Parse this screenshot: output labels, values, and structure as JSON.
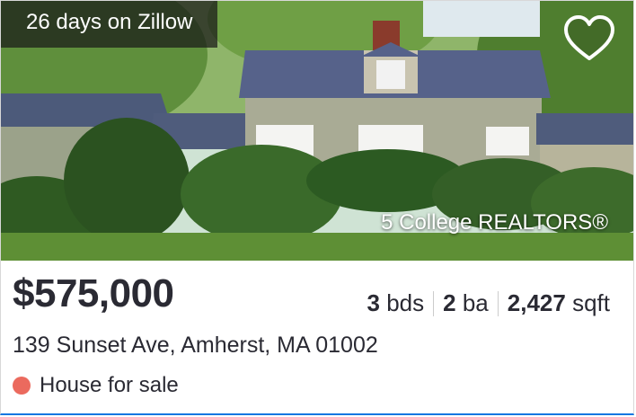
{
  "listing": {
    "days_badge": "26 days on Zillow",
    "attribution": "5 College REALTORS®",
    "price": "$575,000",
    "beds_value": "3",
    "beds_unit": "bds",
    "baths_value": "2",
    "baths_unit": "ba",
    "sqft_value": "2,427",
    "sqft_unit": "sqft",
    "address": "139 Sunset Ave, Amherst, MA 01002",
    "status": "House for sale"
  },
  "icons": {
    "favorite": "heart-icon",
    "status_dot": "status-dot-icon"
  },
  "colors": {
    "status_dot": "#eb6a5e",
    "accent": "#1277e1",
    "text": "#2a2a33"
  }
}
